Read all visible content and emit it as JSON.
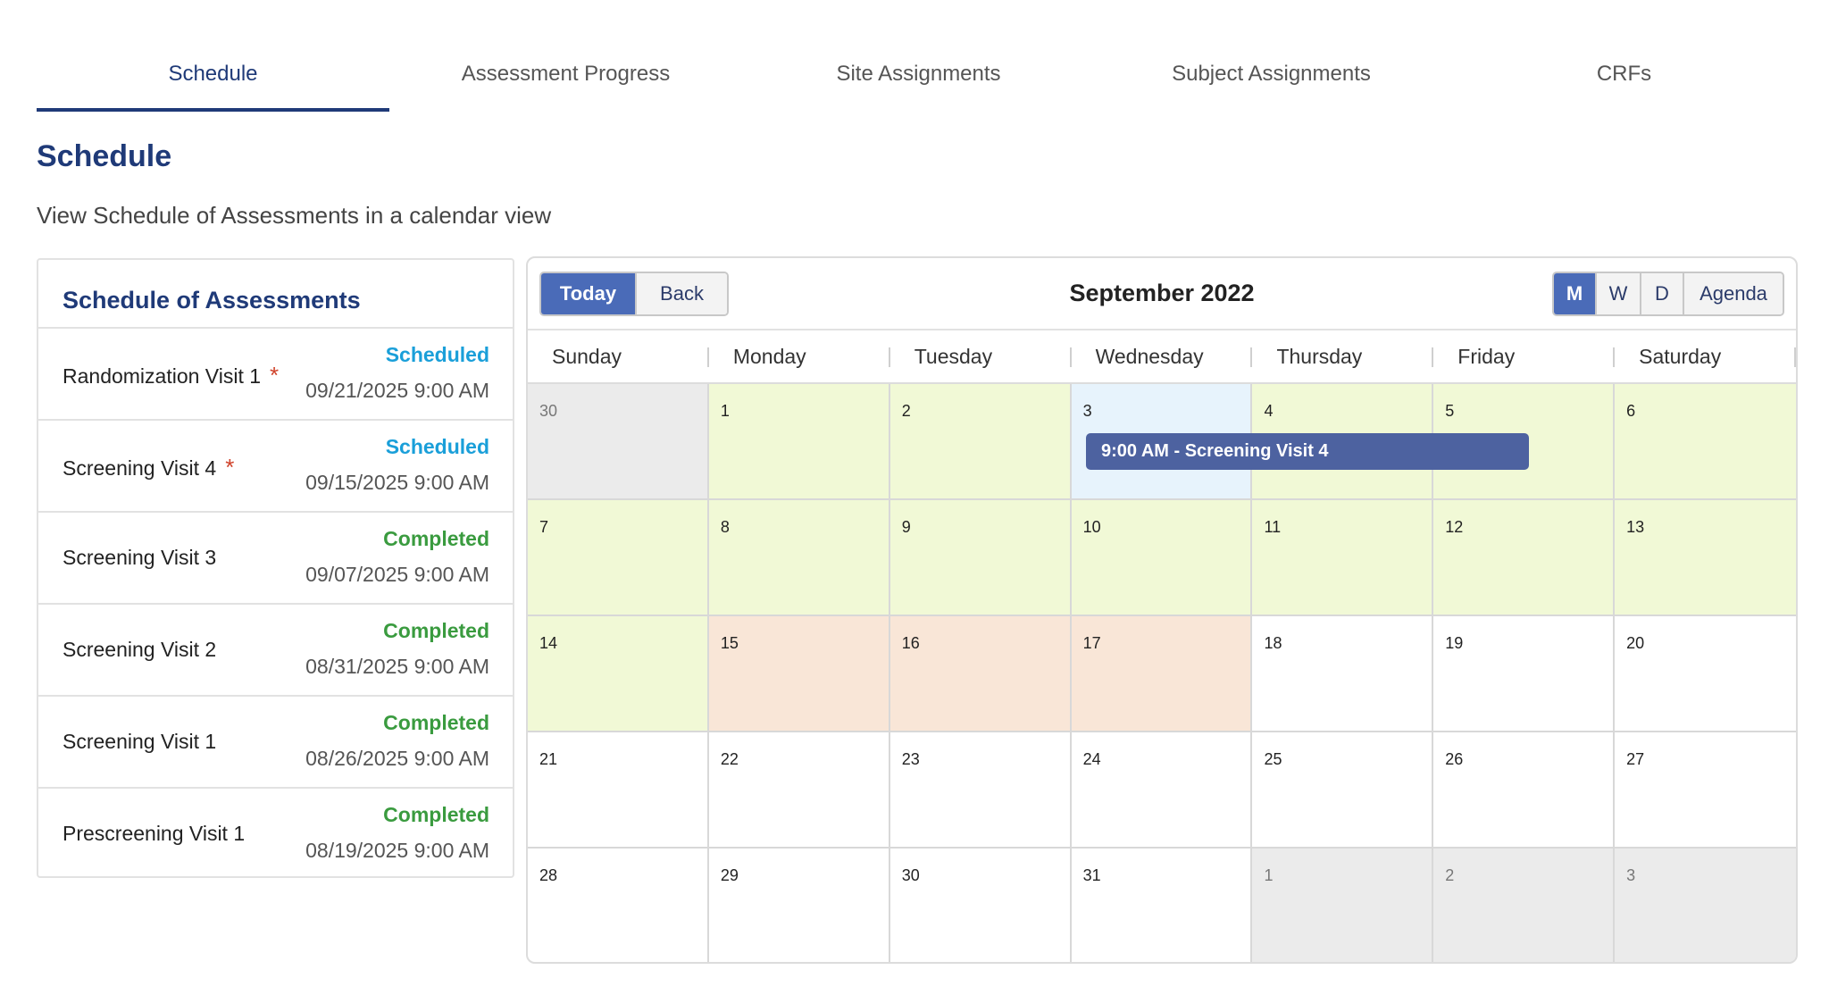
{
  "tabs": [
    {
      "label": "Schedule",
      "active": true
    },
    {
      "label": "Assessment Progress",
      "active": false
    },
    {
      "label": "Site Assignments",
      "active": false
    },
    {
      "label": "Subject Assignments",
      "active": false
    },
    {
      "label": "CRFs",
      "active": false
    }
  ],
  "page": {
    "title": "Schedule",
    "subtitle": "View Schedule of Assessments in a calendar view"
  },
  "soa": {
    "header": "Schedule of Assessments",
    "items": [
      {
        "name": "Randomization Visit 1",
        "required": true,
        "status": "Scheduled",
        "date": "09/21/2025 9:00 AM"
      },
      {
        "name": "Screening Visit 4",
        "required": true,
        "status": "Scheduled",
        "date": "09/15/2025 9:00 AM"
      },
      {
        "name": "Screening Visit 3",
        "required": false,
        "status": "Completed",
        "date": "09/07/2025 9:00 AM"
      },
      {
        "name": "Screening Visit 2",
        "required": false,
        "status": "Completed",
        "date": "08/31/2025 9:00 AM"
      },
      {
        "name": "Screening Visit 1",
        "required": false,
        "status": "Completed",
        "date": "08/26/2025 9:00 AM"
      },
      {
        "name": "Prescreening Visit 1",
        "required": false,
        "status": "Completed",
        "date": "08/19/2025 9:00 AM"
      }
    ],
    "required_marker": "*"
  },
  "calendar": {
    "title": "September 2022",
    "today_label": "Today",
    "back_label": "Back",
    "view_m": "M",
    "view_w": "W",
    "view_d": "D",
    "view_agenda": "Agenda",
    "active_view": "M",
    "weekdays": [
      "Sunday",
      "Monday",
      "Tuesday",
      "Wednesday",
      "Thursday",
      "Friday",
      "Saturday"
    ],
    "weeks": [
      [
        {
          "n": "30",
          "t": "off"
        },
        {
          "n": "1",
          "t": "green"
        },
        {
          "n": "2",
          "t": "green"
        },
        {
          "n": "3",
          "t": "today"
        },
        {
          "n": "4",
          "t": "green"
        },
        {
          "n": "5",
          "t": "green"
        },
        {
          "n": "6",
          "t": "green"
        }
      ],
      [
        {
          "n": "7",
          "t": "green"
        },
        {
          "n": "8",
          "t": "green"
        },
        {
          "n": "9",
          "t": "green"
        },
        {
          "n": "10",
          "t": "green"
        },
        {
          "n": "11",
          "t": "green"
        },
        {
          "n": "12",
          "t": "green"
        },
        {
          "n": "13",
          "t": "green"
        }
      ],
      [
        {
          "n": "14",
          "t": "green"
        },
        {
          "n": "15",
          "t": "peach"
        },
        {
          "n": "16",
          "t": "peach"
        },
        {
          "n": "17",
          "t": "peach"
        },
        {
          "n": "18",
          "t": ""
        },
        {
          "n": "19",
          "t": ""
        },
        {
          "n": "20",
          "t": ""
        }
      ],
      [
        {
          "n": "21",
          "t": ""
        },
        {
          "n": "22",
          "t": ""
        },
        {
          "n": "23",
          "t": ""
        },
        {
          "n": "24",
          "t": ""
        },
        {
          "n": "25",
          "t": ""
        },
        {
          "n": "26",
          "t": ""
        },
        {
          "n": "27",
          "t": ""
        }
      ],
      [
        {
          "n": "28",
          "t": ""
        },
        {
          "n": "29",
          "t": ""
        },
        {
          "n": "30",
          "t": ""
        },
        {
          "n": "31",
          "t": ""
        },
        {
          "n": "1",
          "t": "off"
        },
        {
          "n": "2",
          "t": "off"
        },
        {
          "n": "3",
          "t": "off"
        }
      ]
    ],
    "event": {
      "label": "9:00 AM - Screening Visit 4"
    }
  },
  "colors": {
    "primary": "#1f3a78",
    "button_active": "#4a6bb8",
    "event": "#4d62a0",
    "scheduled": "#1a9fd9",
    "completed": "#3a9b3f",
    "required": "#d0432b",
    "day_green": "#f1f9d6",
    "day_peach": "#f9e6d7",
    "day_today": "#e7f3fc",
    "day_off": "#ebebeb"
  }
}
